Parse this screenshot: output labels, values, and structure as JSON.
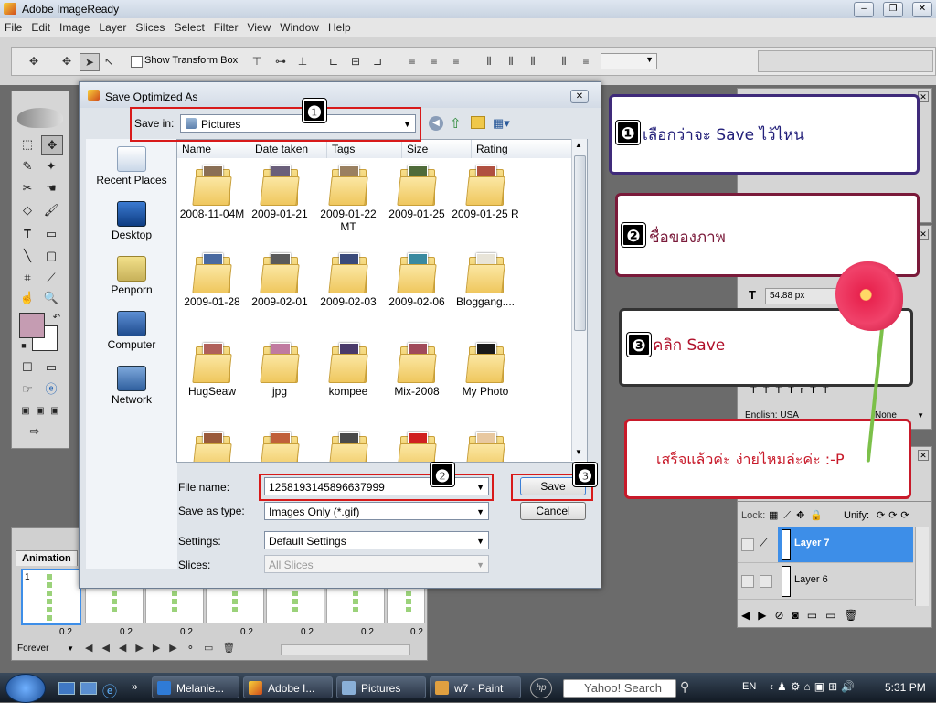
{
  "app": {
    "title": "Adobe ImageReady",
    "window_buttons": [
      "–",
      "❐",
      "✕"
    ]
  },
  "menu": [
    "File",
    "Edit",
    "Image",
    "Layer",
    "Slices",
    "Select",
    "Filter",
    "View",
    "Window",
    "Help"
  ],
  "options": {
    "transform_label": "Show Transform Box"
  },
  "dialog": {
    "title": "Save Optimized As",
    "save_in_label": "Save in:",
    "save_in_value": "Pictures",
    "places": [
      "Recent Places",
      "Desktop",
      "Penporn",
      "Computer",
      "Network"
    ],
    "columns": [
      "Name",
      "Date taken",
      "Tags",
      "Size",
      "Rating"
    ],
    "folders": [
      {
        "name": "2008-11-04M",
        "color": "#8a6f55"
      },
      {
        "name": "2009-01-21",
        "color": "#6a5f7a"
      },
      {
        "name": "2009-01-22 MT",
        "color": "#9a8060"
      },
      {
        "name": "2009-01-25",
        "color": "#4f6b3a"
      },
      {
        "name": "2009-01-25 R",
        "color": "#b05040"
      },
      {
        "name": "2009-01-28",
        "color": "#4a6aa0"
      },
      {
        "name": "2009-02-01",
        "color": "#5a5a5a"
      },
      {
        "name": "2009-02-03",
        "color": "#3a4a7a"
      },
      {
        "name": "2009-02-06",
        "color": "#3a8aa0"
      },
      {
        "name": "Bloggang....",
        "color": "#e8e4d8"
      },
      {
        "name": "HugSeaw",
        "color": "#b0605a"
      },
      {
        "name": "jpg",
        "color": "#c07aa0"
      },
      {
        "name": "kompee",
        "color": "#4a3a6a"
      },
      {
        "name": "Mix-2008",
        "color": "#a04a5a"
      },
      {
        "name": "My Photo",
        "color": "#1a1a1a"
      },
      {
        "name": "",
        "color": "#9a5a3a"
      },
      {
        "name": "",
        "color": "#c0603a"
      },
      {
        "name": "",
        "color": "#4a4a4a"
      },
      {
        "name": "",
        "color": "#d02020"
      },
      {
        "name": "",
        "color": "#e8c8a0"
      }
    ],
    "file_name_label": "File name:",
    "file_name_value": "1258193145896637999",
    "save_type_label": "Save as type:",
    "save_type_value": "Images Only (*.gif)",
    "settings_label": "Settings:",
    "settings_value": "Default Settings",
    "slices_label": "Slices:",
    "slices_value": "All Slices",
    "save_button": "Save",
    "cancel_button": "Cancel"
  },
  "annotations": {
    "n1": "❶",
    "n2": "❷",
    "n3": "❸",
    "callout1": "เลือกว่าจะ  Save  ไว้ไหน",
    "callout2": "ชื่อของภาพ",
    "callout3": "คลิก  Save",
    "callout4": "เสร็จแล้วค่ะ  ง่ายไหมล่ะค่ะ  :-P"
  },
  "right_panels": {
    "font_size": "54.88 px",
    "language": "English: USA",
    "none_label": "None",
    "lock_label": "Lock:",
    "unify_label": "Unify:"
  },
  "animation": {
    "tab": "Animation",
    "frame_number": "1",
    "delays": [
      "0.2",
      "0.2",
      "0.2",
      "0.2",
      "0.2",
      "0.2",
      "0.2"
    ],
    "loop": "Forever"
  },
  "layers": [
    {
      "name": "Layer 7",
      "selected": true
    },
    {
      "name": "Layer 6",
      "selected": false
    }
  ],
  "taskbar": {
    "items": [
      "Melanie...",
      "Adobe I...",
      "Pictures",
      "w7 - Paint"
    ],
    "search": "Yahoo! Search",
    "lang": "EN",
    "time": "5:31 PM"
  }
}
